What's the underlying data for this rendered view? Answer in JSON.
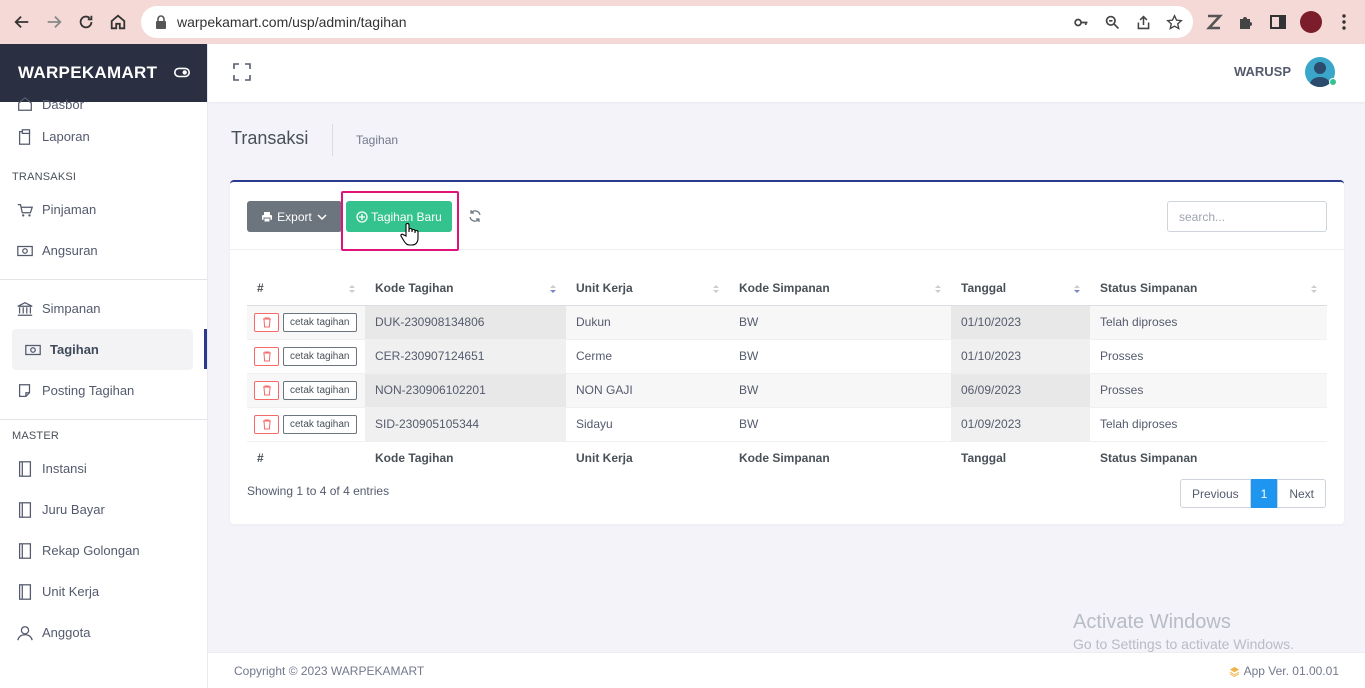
{
  "browser": {
    "url": "warpekamart.com/usp/admin/tagihan"
  },
  "sidebar": {
    "brand": "WARPEKAMART",
    "items_top": [
      {
        "label": "Dasbor",
        "icon": "home-icon"
      },
      {
        "label": "Laporan",
        "icon": "clipboard-icon"
      }
    ],
    "section_transaksi": "TRANSAKSI",
    "transaksi_items": [
      {
        "label": "Pinjaman",
        "icon": "cart-icon"
      },
      {
        "label": "Angsuran",
        "icon": "money-icon"
      }
    ],
    "simpanan_items": [
      {
        "label": "Simpanan",
        "icon": "bank-icon"
      },
      {
        "label": "Tagihan",
        "icon": "money-icon",
        "active": true
      },
      {
        "label": "Posting Tagihan",
        "icon": "note-icon"
      }
    ],
    "section_master": "MASTER",
    "master_items": [
      {
        "label": "Instansi",
        "icon": "book-icon"
      },
      {
        "label": "Juru Bayar",
        "icon": "book-icon"
      },
      {
        "label": "Rekap Golongan",
        "icon": "book-icon"
      },
      {
        "label": "Unit Kerja",
        "icon": "book-icon"
      },
      {
        "label": "Anggota",
        "icon": "user-icon"
      }
    ]
  },
  "header": {
    "user_name": "WARUSP"
  },
  "page": {
    "title": "Transaksi",
    "breadcrumb": "Tagihan"
  },
  "toolbar": {
    "export_label": "Export",
    "new_label": "Tagihan Baru",
    "search_placeholder": "search..."
  },
  "table": {
    "columns": [
      "#",
      "Kode Tagihan",
      "Unit Kerja",
      "Kode Simpanan",
      "Tanggal",
      "Status Simpanan"
    ],
    "print_label": "cetak tagihan",
    "rows": [
      {
        "kode": "DUK-230908134806",
        "unit": "Dukun",
        "simpanan": "BW",
        "tanggal": "01/10/2023",
        "status": "Telah diproses"
      },
      {
        "kode": "CER-230907124651",
        "unit": "Cerme",
        "simpanan": "BW",
        "tanggal": "01/10/2023",
        "status": "Prosses"
      },
      {
        "kode": "NON-230906102201",
        "unit": "NON GAJI",
        "simpanan": "BW",
        "tanggal": "06/09/2023",
        "status": "Prosses"
      },
      {
        "kode": "SID-230905105344",
        "unit": "Sidayu",
        "simpanan": "BW",
        "tanggal": "01/09/2023",
        "status": "Telah diproses"
      }
    ],
    "showing": "Showing 1 to 4 of 4 entries",
    "pager": {
      "prev": "Previous",
      "current": "1",
      "next": "Next"
    }
  },
  "watermark": {
    "line1": "Activate Windows",
    "line2": "Go to Settings to activate Windows."
  },
  "footer": {
    "copyright": "Copyright © 2023 WARPEKAMART",
    "version": "App Ver. 01.00.01"
  }
}
